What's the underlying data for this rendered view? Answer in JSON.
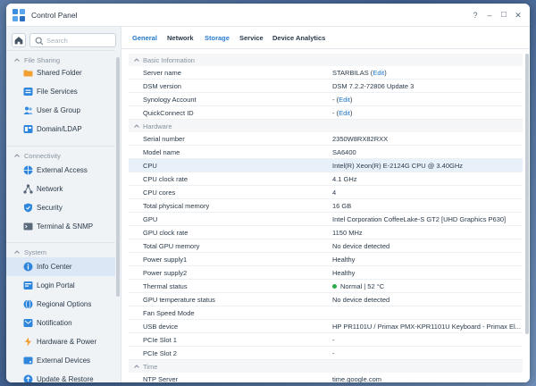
{
  "window": {
    "title": "Control Panel"
  },
  "window_controls": {
    "help": "?",
    "minimize": "–",
    "maximize": "□",
    "close": "✕"
  },
  "sidebar": {
    "search_placeholder": "Search",
    "sections": [
      {
        "label": "File Sharing",
        "items": [
          {
            "label": "Shared Folder",
            "icon": "folder-icon"
          },
          {
            "label": "File Services",
            "icon": "file-services-icon"
          },
          {
            "label": "User & Group",
            "icon": "user-group-icon"
          },
          {
            "label": "Domain/LDAP",
            "icon": "domain-icon"
          }
        ]
      },
      {
        "label": "Connectivity",
        "items": [
          {
            "label": "External Access",
            "icon": "globe-icon"
          },
          {
            "label": "Network",
            "icon": "network-icon"
          },
          {
            "label": "Security",
            "icon": "shield-icon"
          },
          {
            "label": "Terminal & SNMP",
            "icon": "terminal-icon"
          }
        ]
      },
      {
        "label": "System",
        "items": [
          {
            "label": "Info Center",
            "icon": "info-icon",
            "active": true
          },
          {
            "label": "Login Portal",
            "icon": "login-portal-icon"
          },
          {
            "label": "Regional Options",
            "icon": "globe-icon"
          },
          {
            "label": "Notification",
            "icon": "notification-icon"
          },
          {
            "label": "Hardware & Power",
            "icon": "hardware-icon"
          },
          {
            "label": "External Devices",
            "icon": "external-devices-icon"
          },
          {
            "label": "Update & Restore",
            "icon": "update-icon"
          }
        ]
      }
    ]
  },
  "tabs": [
    {
      "label": "General",
      "active": true
    },
    {
      "label": "Network"
    },
    {
      "label": "Storage"
    },
    {
      "label": "Service"
    },
    {
      "label": "Device Analytics"
    }
  ],
  "groups": {
    "basic": {
      "label": "Basic Information",
      "rows": [
        {
          "label": "Server name",
          "value": "STARBILAS",
          "link": "Edit"
        },
        {
          "label": "DSM version",
          "value": "DSM 7.2.2-72806 Update 3"
        },
        {
          "label": "Synology Account",
          "value": "-",
          "link": "Edit"
        },
        {
          "label": "QuickConnect ID",
          "value": "-",
          "link": "Edit"
        }
      ]
    },
    "hardware": {
      "label": "Hardware",
      "rows": [
        {
          "label": "Serial number",
          "value": "2350W8RX82RXX"
        },
        {
          "label": "Model name",
          "value": "SA6400"
        },
        {
          "label": "CPU",
          "value": "Intel(R) Xeon(R) E-2124G CPU @ 3.40GHz",
          "highlight": true
        },
        {
          "label": "CPU clock rate",
          "value": "4.1 GHz"
        },
        {
          "label": "CPU cores",
          "value": "4"
        },
        {
          "label": "Total physical memory",
          "value": "16 GB"
        },
        {
          "label": "GPU",
          "value": "Intel Corporation CoffeeLake-S GT2 [UHD Graphics P630]"
        },
        {
          "label": "GPU clock rate",
          "value": "1150 MHz"
        },
        {
          "label": "Total GPU memory",
          "value": "No device detected"
        },
        {
          "label": "Power supply1",
          "value": "Healthy"
        },
        {
          "label": "Power supply2",
          "value": "Healthy"
        },
        {
          "label": "Thermal status",
          "value": "Normal | 52 °C",
          "status": "normal"
        },
        {
          "label": "GPU temperature status",
          "value": "No device detected"
        },
        {
          "label": "Fan Speed Mode",
          "value": ""
        },
        {
          "label": "USB device",
          "value": "HP PR1101U / Primax PMX-KPR1101U Keyboard - Primax El..."
        },
        {
          "label": "PCIe Slot 1",
          "value": "-"
        },
        {
          "label": "PCIe Slot 2",
          "value": "-"
        }
      ]
    },
    "time": {
      "label": "Time",
      "rows": [
        {
          "label": "NTP Server",
          "value": "time.google.com"
        }
      ]
    }
  },
  "colors": {
    "accent": "#1f77c9",
    "status_green": "#2eaa4a",
    "sidebar_bg": "#f0f3f6",
    "active_item_bg": "#dce7f5"
  }
}
